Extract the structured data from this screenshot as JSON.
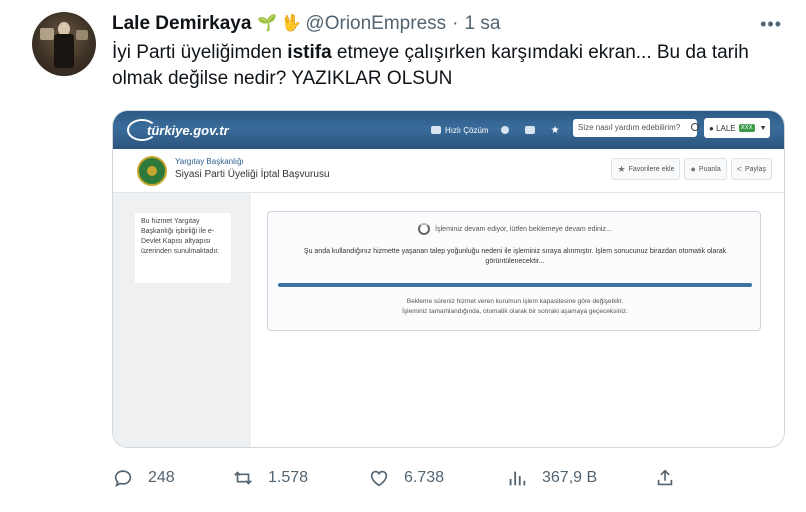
{
  "tweet": {
    "author_name": "Lale Demirkaya",
    "emoji1": "🌱",
    "emoji2": "🖖",
    "handle": "@OrionEmpress",
    "separator": "·",
    "time": "1 sa",
    "text_before": "İyi Parti üyeliğimden ",
    "text_bold": "istifa",
    "text_after": " etmeye çalışırken karşımdaki ekran... Bu da tarih olmak değilse nedir? YAZIKLAR OLSUN"
  },
  "screenshot": {
    "logo": "türkiye.gov.tr",
    "tools": [
      "Hızlı Çözüm"
    ],
    "search_placeholder": "Size nasıl yardım edebilirim?",
    "user_label": "LALE",
    "user_badge": "XXX",
    "org": "Yargıtay Başkanlığı",
    "service": "Siyasi Parti Üyeliği İptal Başvurusu",
    "favorite": "Favorilere ekle",
    "rate": "Puanla",
    "share": "Paylaş",
    "side_text": "Bu hizmet Yargıtay Başkanlığı işbirliği ile e-Devlet Kapısı altyapısı üzerinden sunulmaktadır.",
    "line1": "İşleminiz devam ediyor, lütfen beklemeye devam ediniz...",
    "line2": "Şu anda kullandığınız hizmette yaşanan talep yoğunluğu nedeni ile işleminiz sıraya alınmıştır. İşlem sonucunuz birazdan otomatik olarak görüntülenecektir...",
    "progress": 1.0,
    "line3a": "Bekleme süreniz hizmet veren kurumun işlem kapasitesine göre değişebilir.",
    "line3b": "İşleminiz tamamlandığında, otomatik olarak bir sonraki aşamaya geçeceksiniz."
  },
  "actions": {
    "replies": "248",
    "retweets": "1.578",
    "likes": "6.738",
    "views": "367,9 B"
  },
  "icons": [
    "more-icon",
    "reply-icon",
    "retweet-icon",
    "like-icon",
    "views-icon",
    "share-icon"
  ]
}
